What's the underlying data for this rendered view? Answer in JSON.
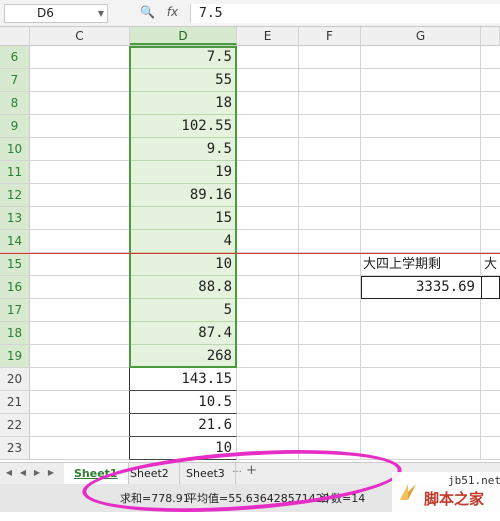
{
  "formula_bar": {
    "cell_ref": "D6",
    "fx_label": "fx",
    "value": "7.5"
  },
  "columns": [
    "C",
    "D",
    "E",
    "F",
    "G"
  ],
  "rows": [
    {
      "num": "6",
      "d": "7.5"
    },
    {
      "num": "7",
      "d": "55"
    },
    {
      "num": "8",
      "d": "18"
    },
    {
      "num": "9",
      "d": "102.55"
    },
    {
      "num": "10",
      "d": "9.5"
    },
    {
      "num": "11",
      "d": "19"
    },
    {
      "num": "12",
      "d": "89.16"
    },
    {
      "num": "13",
      "d": "15"
    },
    {
      "num": "14",
      "d": "4"
    },
    {
      "num": "15",
      "d": "10"
    },
    {
      "num": "16",
      "d": "88.8"
    },
    {
      "num": "17",
      "d": "5"
    },
    {
      "num": "18",
      "d": "87.4"
    },
    {
      "num": "19",
      "d": "268"
    },
    {
      "num": "20",
      "d": "143.15"
    },
    {
      "num": "21",
      "d": "10.5"
    },
    {
      "num": "22",
      "d": "21.6"
    },
    {
      "num": "23",
      "d": "10"
    }
  ],
  "side_labels": {
    "g15": "大四上学期剩",
    "h15": "大",
    "g16": "3335.69"
  },
  "sheet_tabs": [
    "Sheet1",
    "Sheet2",
    "Sheet3"
  ],
  "tab_more": "···",
  "tab_add": "+",
  "status": {
    "sum": "求和=778.91",
    "avg": "平均值=55.636428571429",
    "count": "计数=14"
  },
  "watermark": {
    "url": "jb51.net",
    "name": "脚本之家"
  },
  "colors": {
    "selection": "#4a9a3f",
    "selection_fill": "#e5f2dd",
    "annotation": "#e62ec7",
    "freeze_line": "#dd3333"
  }
}
